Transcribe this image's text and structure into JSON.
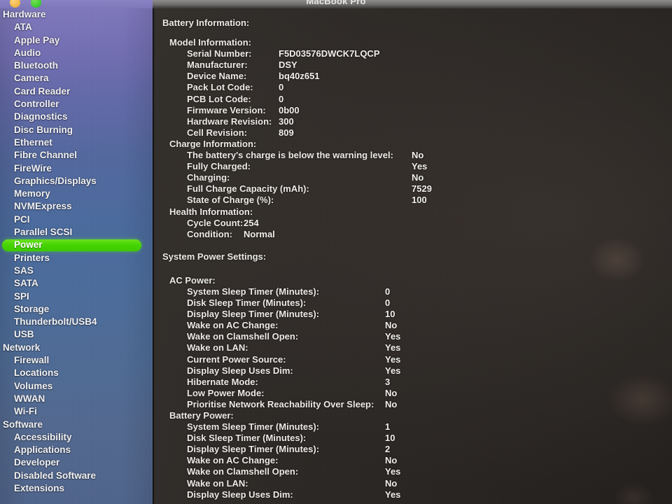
{
  "window": {
    "title": "MacBook Pro",
    "traffic_lights": [
      "minimize-yellow",
      "zoom-green"
    ]
  },
  "sidebar": {
    "selected": "Power",
    "items": [
      {
        "label": "Hardware",
        "level": "group"
      },
      {
        "label": "ATA",
        "level": "child"
      },
      {
        "label": "Apple Pay",
        "level": "child"
      },
      {
        "label": "Audio",
        "level": "child"
      },
      {
        "label": "Bluetooth",
        "level": "child"
      },
      {
        "label": "Camera",
        "level": "child"
      },
      {
        "label": "Card Reader",
        "level": "child"
      },
      {
        "label": "Controller",
        "level": "child"
      },
      {
        "label": "Diagnostics",
        "level": "child"
      },
      {
        "label": "Disc Burning",
        "level": "child"
      },
      {
        "label": "Ethernet",
        "level": "child"
      },
      {
        "label": "Fibre Channel",
        "level": "child"
      },
      {
        "label": "FireWire",
        "level": "child"
      },
      {
        "label": "Graphics/Displays",
        "level": "child"
      },
      {
        "label": "Memory",
        "level": "child"
      },
      {
        "label": "NVMExpress",
        "level": "child"
      },
      {
        "label": "PCI",
        "level": "child"
      },
      {
        "label": "Parallel SCSI",
        "level": "child"
      },
      {
        "label": "Power",
        "level": "child",
        "selected": true
      },
      {
        "label": "Printers",
        "level": "child"
      },
      {
        "label": "SAS",
        "level": "child"
      },
      {
        "label": "SATA",
        "level": "child"
      },
      {
        "label": "SPI",
        "level": "child"
      },
      {
        "label": "Storage",
        "level": "child"
      },
      {
        "label": "Thunderbolt/USB4",
        "level": "child"
      },
      {
        "label": "USB",
        "level": "child"
      },
      {
        "label": "Network",
        "level": "group"
      },
      {
        "label": "Firewall",
        "level": "child"
      },
      {
        "label": "Locations",
        "level": "child"
      },
      {
        "label": "Volumes",
        "level": "child"
      },
      {
        "label": "WWAN",
        "level": "child"
      },
      {
        "label": "Wi-Fi",
        "level": "child"
      },
      {
        "label": "Software",
        "level": "group"
      },
      {
        "label": "Accessibility",
        "level": "child"
      },
      {
        "label": "Applications",
        "level": "child"
      },
      {
        "label": "Developer",
        "level": "child"
      },
      {
        "label": "Disabled Software",
        "level": "child"
      },
      {
        "label": "Extensions",
        "level": "child"
      }
    ]
  },
  "content": {
    "battery_information_heading": "Battery Information:",
    "model_information_heading": "Model Information:",
    "model_information": [
      {
        "key": "Serial Number:",
        "value": "F5D03576DWCK7LQCP"
      },
      {
        "key": "Manufacturer:",
        "value": "DSY"
      },
      {
        "key": "Device Name:",
        "value": "bq40z651"
      },
      {
        "key": "Pack Lot Code:",
        "value": "0"
      },
      {
        "key": "PCB Lot Code:",
        "value": "0"
      },
      {
        "key": "Firmware Version:",
        "value": "0b00"
      },
      {
        "key": "Hardware Revision:",
        "value": "300"
      },
      {
        "key": "Cell Revision:",
        "value": "809"
      }
    ],
    "charge_information_heading": "Charge Information:",
    "charge_information": [
      {
        "key": "The battery's charge is below the warning level:",
        "value": "No"
      },
      {
        "key": "Fully Charged:",
        "value": "Yes"
      },
      {
        "key": "Charging:",
        "value": "No"
      },
      {
        "key": "Full Charge Capacity (mAh):",
        "value": "7529"
      },
      {
        "key": "State of Charge (%):",
        "value": "100"
      }
    ],
    "health_information_heading": "Health Information:",
    "health_information": [
      {
        "key": "Cycle Count:",
        "value": "254"
      },
      {
        "key": "Condition:",
        "value": "Normal"
      }
    ],
    "system_power_settings_heading": "System Power Settings:",
    "ac_power_heading": "AC Power:",
    "ac_power": [
      {
        "key": "System Sleep Timer (Minutes):",
        "value": "0"
      },
      {
        "key": "Disk Sleep Timer (Minutes):",
        "value": "0"
      },
      {
        "key": "Display Sleep Timer (Minutes):",
        "value": "10"
      },
      {
        "key": "Wake on AC Change:",
        "value": "No"
      },
      {
        "key": "Wake on Clamshell Open:",
        "value": "Yes"
      },
      {
        "key": "Wake on LAN:",
        "value": "Yes"
      },
      {
        "key": "Current Power Source:",
        "value": "Yes"
      },
      {
        "key": "Display Sleep Uses Dim:",
        "value": "Yes"
      },
      {
        "key": "Hibernate Mode:",
        "value": "3"
      },
      {
        "key": "Low Power Mode:",
        "value": "No"
      },
      {
        "key": "Prioritise Network Reachability Over Sleep:",
        "value": "No"
      }
    ],
    "battery_power_heading": "Battery Power:",
    "battery_power": [
      {
        "key": "System Sleep Timer (Minutes):",
        "value": "1"
      },
      {
        "key": "Disk Sleep Timer (Minutes):",
        "value": "10"
      },
      {
        "key": "Display Sleep Timer (Minutes):",
        "value": "2"
      },
      {
        "key": "Wake on AC Change:",
        "value": "No"
      },
      {
        "key": "Wake on Clamshell Open:",
        "value": "Yes"
      },
      {
        "key": "Wake on LAN:",
        "value": "No"
      },
      {
        "key": "Display Sleep Uses Dim:",
        "value": "Yes"
      }
    ]
  },
  "colors": {
    "selection_green": "#44d400",
    "sidebar_top": "#8079bd",
    "sidebar_bottom": "#4f648c",
    "content_background": "#2a2622",
    "text": "#eceae7"
  }
}
